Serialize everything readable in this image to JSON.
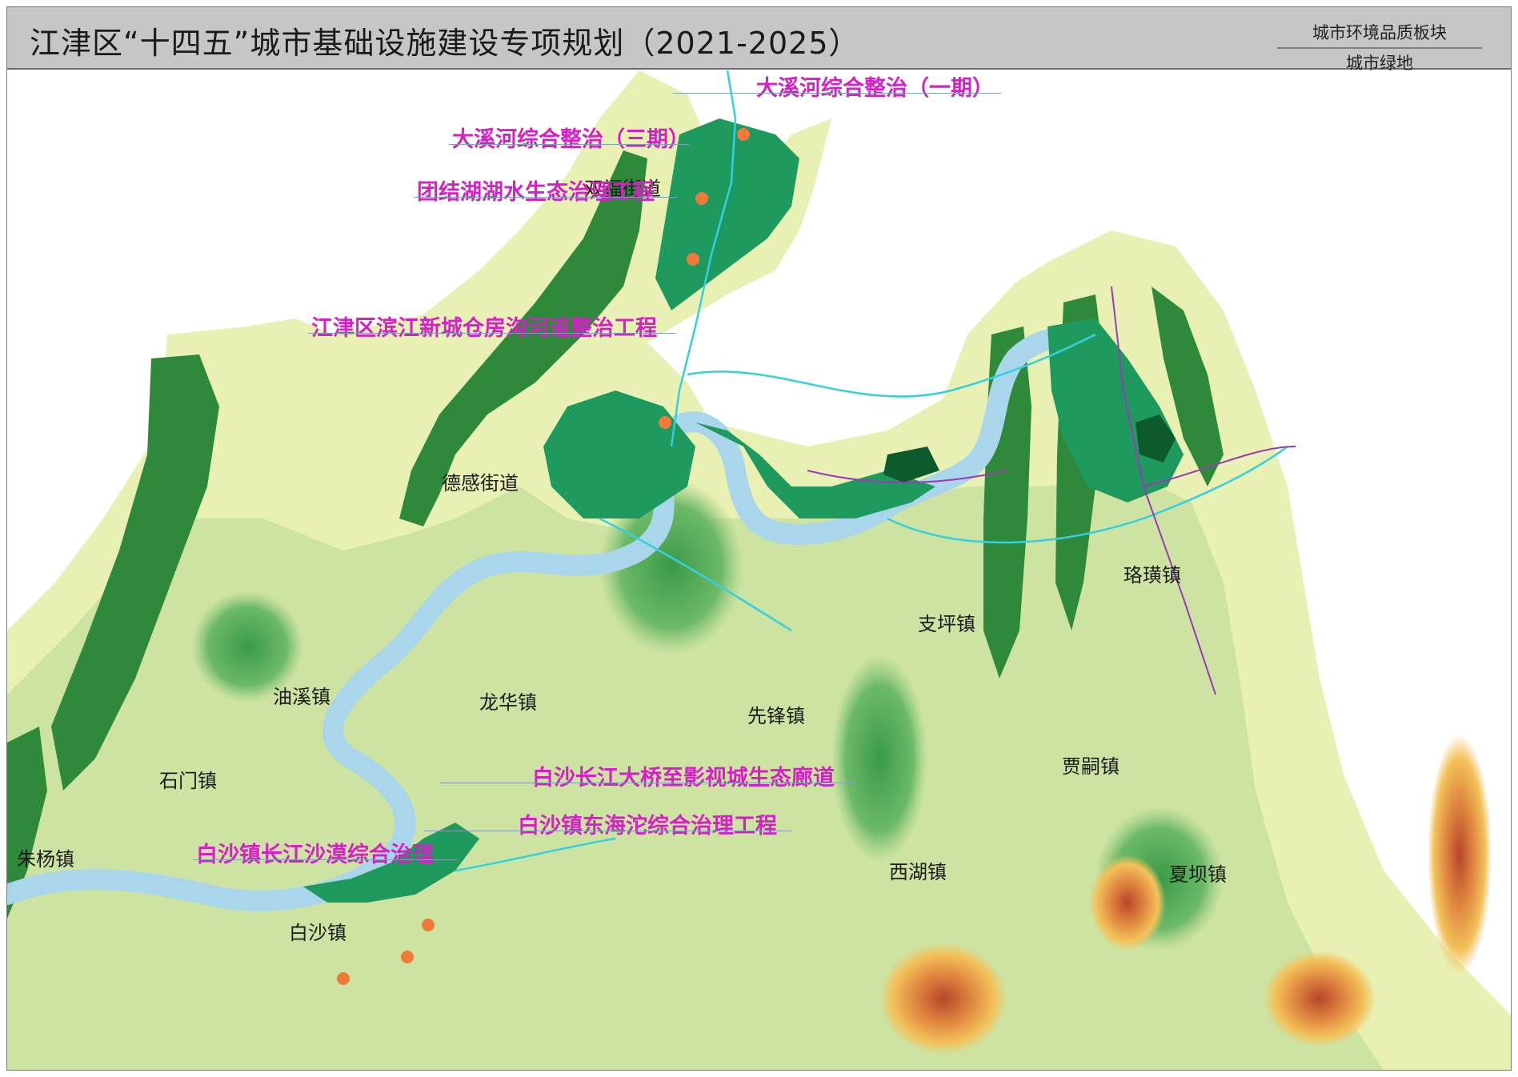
{
  "header": {
    "title": "江津区“十四五”城市基础设施建设专项规划（2021-2025）",
    "board_line1": "城市环境品质板块",
    "board_line2": "城市绿地"
  },
  "map": {
    "colors": {
      "lowland": "#e9f0b4",
      "plain": "#cde3a2",
      "hill": "#8bc77a",
      "ridge": "#2e8a3a",
      "river": "#a9d6ea",
      "urban": "#1f9a5e",
      "highland_red": "#c9562c",
      "highland_yellow": "#f0b04a",
      "project_dot": "#f07a3a",
      "project_label": "#d61fc6"
    },
    "towns": {
      "shuangfu": "双福街道",
      "degan": "德感街道",
      "luohuang": "珞璜镇",
      "zhiping": "支坪镇",
      "youxi": "油溪镇",
      "longhua": "龙华镇",
      "xianfeng": "先锋镇",
      "jiasi": "贾嗣镇",
      "shimen": "石门镇",
      "zhuyang": "朱杨镇",
      "xihu": "西湖镇",
      "xiaba": "夏坝镇",
      "baisha": "白沙镇"
    },
    "projects": {
      "p1": "大溪河综合整治（一期）",
      "p2": "大溪河综合整治（三期）",
      "p3": "团结湖湖水生态治理工程",
      "p4": "江津区滨江新城仓房沟河道整治工程",
      "p5": "白沙长江大桥至影视城生态廊道",
      "p6": "白沙镇东海沱综合治理工程",
      "p7": "白沙镇长江沙漠综合治理"
    }
  }
}
